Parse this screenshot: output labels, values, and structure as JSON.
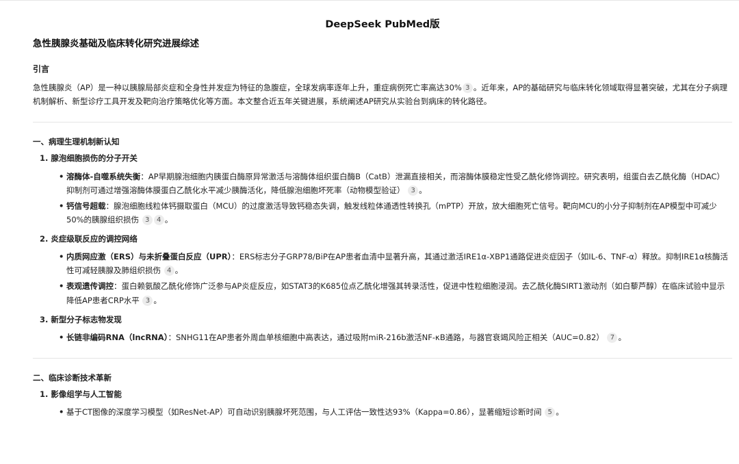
{
  "app_title": "DeepSeek PubMed版",
  "doc_title": "急性胰腺炎基础及临床转化研究进展综述",
  "intro": {
    "heading": "引言",
    "para_a": "急性胰腺炎（AP）是一种以胰腺局部炎症和全身性并发症为特征的急腹症，全球发病率逐年上升，重症病例死亡率高达30%",
    "cite_1": "3",
    "para_b": "。近年来，AP的基础研究与临床转化领域取得显著突破，尤其在分子病理机制解析、新型诊疗工具开发及靶向治疗策略优化等方面。本文整合近五年关键进展，系统阐述AP研究从实验台到病床的转化路径。"
  },
  "sections": [
    {
      "heading": "一、病理生理机制新认知",
      "subsections": [
        {
          "heading": "1. 腺泡细胞损伤的分子开关",
          "items": [
            {
              "term": "溶酶体-自噬系统失衡",
              "text": "：AP早期腺泡细胞内胰蛋白酶原异常激活与溶酶体组织蛋白酶B（CatB）泄漏直接相关，而溶酶体膜稳定性受乙酰化修饰调控。研究表明，组蛋白去乙酰化酶（HDAC）抑制剂可通过增强溶酶体膜蛋白乙酰化水平减少胰酶活化，降低腺泡细胞坏死率（动物模型验证）",
              "cites": [
                "3"
              ],
              "tail": "。"
            },
            {
              "term": "钙信号超载",
              "text": "：腺泡细胞线粒体钙摄取蛋白（MCU）的过度激活导致钙稳态失调，触发线粒体通透性转换孔（mPTP）开放，放大细胞死亡信号。靶向MCU的小分子抑制剂在AP模型中可减少50%的胰腺组织损伤",
              "cites": [
                "3",
                "4"
              ],
              "tail": "。"
            }
          ]
        },
        {
          "heading": "2. 炎症级联反应的调控网络",
          "items": [
            {
              "term": "内质网应激（ERS）与未折叠蛋白反应（UPR）",
              "text": "：ERS标志分子GRP78/BiP在AP患者血清中显著升高，其通过激活IRE1α-XBP1通路促进炎症因子（如IL-6、TNF-α）释放。抑制IRE1α核酶活性可减轻胰腺及肺组织损伤",
              "cites": [
                "4"
              ],
              "tail": "。"
            },
            {
              "term": "表观遗传调控",
              "text": "：蛋白赖氨酸乙酰化修饰广泛参与AP炎症反应，如STAT3的K685位点乙酰化增强其转录活性，促进中性粒细胞浸润。去乙酰化酶SIRT1激动剂（如白藜芦醇）在临床试验中显示降低AP患者CRP水平",
              "cites": [
                "3"
              ],
              "tail": "。"
            }
          ]
        },
        {
          "heading": "3. 新型分子标志物发现",
          "items": [
            {
              "term": "长链非编码RNA（lncRNA）",
              "text": "：SNHG11在AP患者外周血单核细胞中高表达，通过吸附miR-216b激活NF-κB通路，与器官衰竭风险正相关（AUC=0.82）",
              "cites": [
                "7"
              ],
              "tail": "。"
            }
          ]
        }
      ]
    },
    {
      "heading": "二、临床诊断技术革新",
      "subsections": [
        {
          "heading": "1. 影像组学与人工智能",
          "items": [
            {
              "term": "",
              "text": "基于CT图像的深度学习模型（如ResNet-AP）可自动识别胰腺坏死范围，与人工评估一致性达93%（Kappa=0.86），显著缩短诊断时间",
              "cites": [
                "5"
              ],
              "tail": "。"
            }
          ]
        }
      ]
    }
  ]
}
